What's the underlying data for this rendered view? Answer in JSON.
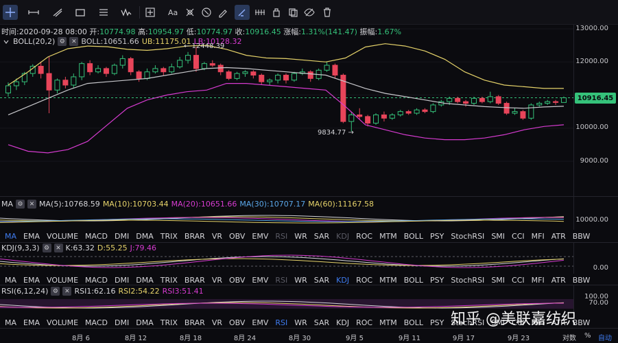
{
  "toolbar": {
    "icons": [
      "crosshair-icon",
      "horizontal-line-icon",
      "trend-line-icon",
      "rectangle-icon",
      "fib-icon",
      "wave-icon",
      "measure-icon",
      "text-icon",
      "pattern-icon",
      "ruler-icon",
      "brush-icon",
      "magnet-icon",
      "lock-icon",
      "clone-icon",
      "eye-off-icon",
      "trash-icon"
    ]
  },
  "ohlc": {
    "time_label": "时间:",
    "time": "2020-09-28 08:00",
    "open_label": "开:",
    "open": "10774.98",
    "high_label": "高:",
    "high": "10954.97",
    "low_label": "低:",
    "low": "10774.97",
    "close_label": "收:",
    "close": "10916.45",
    "chg_label": "涨幅:",
    "chg": "1.31%(141.47)",
    "amp_label": "振幅:",
    "amp": "1.67%"
  },
  "boll": {
    "name": "BOLL(20,2)",
    "mid": "BOLL:10651.66",
    "ub": "UB:11175.01",
    "lb": "LB:10128.32"
  },
  "annotations": {
    "high_mark": "← 12448.39",
    "low_mark": "9834.77 →"
  },
  "price_axis": {
    "labels": [
      "13000.00",
      "12000.00",
      "11000.00",
      "10000.00",
      "9000.00"
    ],
    "current": "10916.45"
  },
  "ma": {
    "name": "MA",
    "ma5": "MA(5):10768.59",
    "ma10": "MA(10):10703.44",
    "ma20": "MA(20):10651.66",
    "ma30": "MA(30):10707.17",
    "ma60": "MA(60):11167.58",
    "axis": "10000.00"
  },
  "kdj": {
    "name": "KDJ(9,3,3)",
    "k": "K:63.32",
    "d": "D:55.25",
    "j": "J:79.46",
    "axis": "0.00"
  },
  "rsi": {
    "name": "RSI(6,12,24)",
    "rsi1": "RSI1:62.16",
    "rsi2": "RSI2:54.22",
    "rsi3": "RSI3:51.41",
    "axis_top": "100.00",
    "axis_mid": "70.00"
  },
  "tabs": [
    "MA",
    "EMA",
    "VOLUME",
    "MACD",
    "DMI",
    "DMA",
    "TRIX",
    "BRAR",
    "VR",
    "OBV",
    "EMV",
    "RSI",
    "WR",
    "SAR",
    "KDJ",
    "ROC",
    "MTM",
    "BOLL",
    "PSY",
    "StochRSI",
    "SMI",
    "CCI",
    "MFI",
    "ATR",
    "BBW"
  ],
  "dates": [
    "8月 6",
    "8月 12",
    "8月 18",
    "8月 24",
    "8月 30",
    "9月 5",
    "9月 11",
    "9月 17",
    "9月 23"
  ],
  "bottom": {
    "log": "对数",
    "pct": "%",
    "auto": "自动"
  },
  "watermark": "知乎 @美联嘉纺织",
  "colors": {
    "up": "#35c27a",
    "down": "#e8455a",
    "ub": "#e6d36a",
    "lb": "#d63bd0",
    "mid": "#c8c8cc",
    "tab_selected": "#3f7cf0"
  }
}
